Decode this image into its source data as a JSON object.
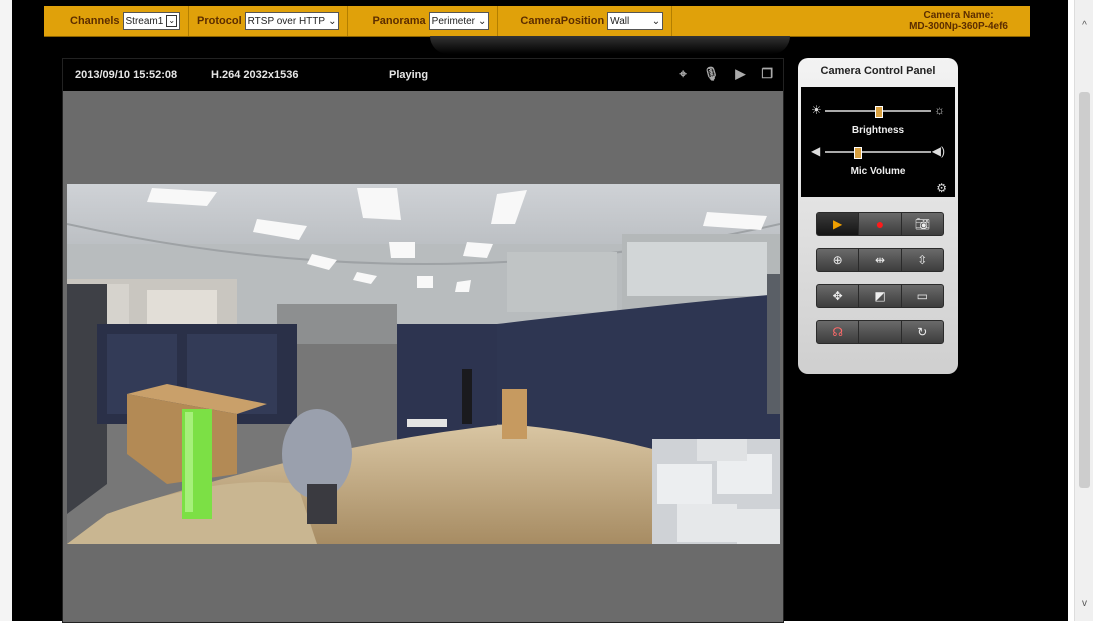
{
  "toolbar": {
    "channels_label": "Channels",
    "channels_value": "Stream1",
    "protocol_label": "Protocol",
    "protocol_value": "RTSP over HTTP",
    "panorama_label": "Panorama",
    "panorama_value": "Perimeter",
    "position_label": "CameraPosition",
    "position_value": "Wall",
    "camera_name_label": "Camera Name:",
    "camera_name_value": "MD-300Np-360P-4ef6"
  },
  "player": {
    "datetime": "2013/09/10 15:52:08",
    "codec": "H.264  2032x1536",
    "status": "Playing"
  },
  "control_panel": {
    "title": "Camera Control Panel",
    "brightness_label": "Brightness",
    "brightness_level": 0.5,
    "mic_label": "Mic Volume",
    "mic_level": 0.3
  }
}
